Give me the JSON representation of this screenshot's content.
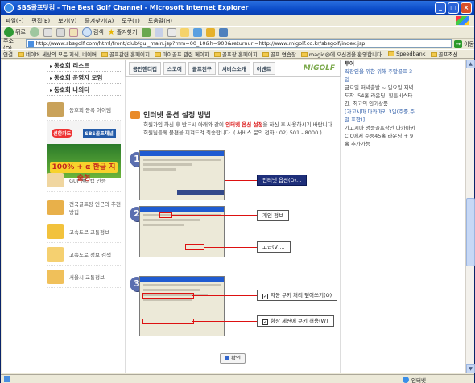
{
  "window": {
    "title": "SBS골프닷컴 - The Best Golf Channel - Microsoft Internet Explorer",
    "controls": [
      "_",
      "□",
      "×"
    ]
  },
  "menu": [
    "파일(F)",
    "편집(E)",
    "보기(V)",
    "즐겨찾기(A)",
    "도구(T)",
    "도움말(H)"
  ],
  "toolbar": {
    "back": "뒤로",
    "search": "검색",
    "favorites": "즐겨찾기"
  },
  "address": {
    "label": "주소(D)",
    "url": "http://www.sbsgolf.com/html/front/club/gui_main.jsp?mm=00_10&h=900&returnurl=http://www.migolf.co.kr/sbsgolf/index.jsp",
    "go": "이동"
  },
  "links": {
    "label": "연결",
    "items": [
      "네이버 세상의 모든 지식, 네이버",
      "골프관련 홈페이지",
      "마이골프 관련 페이지",
      "골프장 홈페이지",
      "골프 연습장",
      "magic@에 오신것을 환영합니다.",
      "Speedbank",
      "골프조선"
    ]
  },
  "sidebar": {
    "club_items": [
      "동호회 리스트",
      "동호회 운영자 모임",
      "동호회 나의터"
    ],
    "rows": [
      {
        "label": "동호회 등록 아이템",
        "icon": "golf-bag-icon"
      },
      {
        "label": "GUI 핸디캡 인증",
        "icon": "golf-ball-icon"
      },
      {
        "label": "전국골프장 인근의 추천방집",
        "icon": "house-icon"
      },
      {
        "label": "고속도로 교통정보",
        "icon": "car-icon"
      },
      {
        "label": "고속도로 정보 검색",
        "icon": "road-sign-icon"
      },
      {
        "label": "서울시 교통정보",
        "icon": "bus-icon"
      }
    ],
    "promo": {
      "brand1": "신한카드",
      "brand2": "SBS골프채널",
      "headline": "100% + α 환급 지출형"
    }
  },
  "header_tabs": [
    "공인핸디캡",
    "스코어",
    "골프친구",
    "서비스소개",
    "이벤트"
  ],
  "logo_text": "MIGOLF",
  "right_col": {
    "head": "투어",
    "lines": [
      "직장인을 위한 위해 주말골프 3일",
      "금요일 저녁출발 ~ 일요일 저녁 도착. 54홀 라운딩. 힐튼비스타 간, 최고의 인기상품",
      "[가고시마 다카마키 3일(주중,주말 포함)]",
      "가고시마 명품골프장인 다카마키C.C에서 주중45홀 라운딩 + 9홀 추가가능"
    ]
  },
  "section": {
    "title": "인터넷 옵션 설정 방법",
    "notice_pre": "회원가입 하신 후 반드시 아래와 같이 ",
    "notice_red": "인터넷 옵션 설정",
    "notice_post": "을 하신 후 사용하시기 바랍니다.",
    "notice_line2": "회원님들께 불편을 끼쳐드려 죄송합니다. ( 서비스 문의 전화 : 02) 501 - 8000 )"
  },
  "steps": [
    {
      "num": "1",
      "callouts": [
        "인터넷 옵션(O)..."
      ]
    },
    {
      "num": "2",
      "callouts": [
        "개인 정보",
        "고급(V)..."
      ]
    },
    {
      "num": "3",
      "callouts": [
        "자동 쿠키 처리 덮어쓰기(O)",
        "항상 세션에 쿠키 허용(W)"
      ]
    }
  ],
  "confirm_label": "확인",
  "status": {
    "zone": "인터넷"
  }
}
